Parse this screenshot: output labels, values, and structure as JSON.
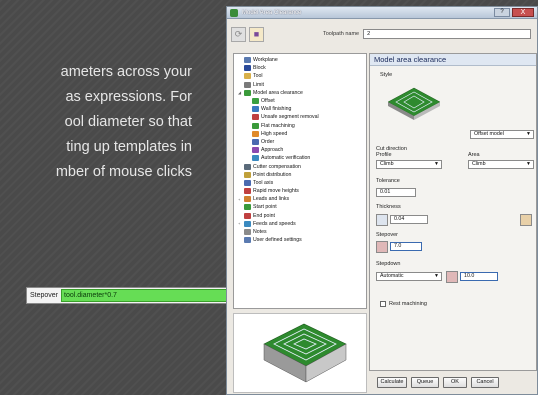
{
  "background_text": {
    "lines": [
      "ameters across your",
      "as expressions. For",
      "ool diameter so that",
      "ting up templates in",
      "mber of mouse clicks"
    ]
  },
  "expression_bar": {
    "label": "Stepover",
    "value": "tool.diameter*0.7",
    "accent_color": "#66dd55"
  },
  "dialog": {
    "title": "Model Area Clearance",
    "help_label": "?",
    "close_label": "X",
    "toolpath_name_label": "Toolpath name",
    "toolpath_name_value": "2",
    "tree": [
      {
        "label": "Workplane",
        "indent": 0,
        "color": "#5a7ab0"
      },
      {
        "label": "Block",
        "indent": 0,
        "color": "#2a4a9a"
      },
      {
        "label": "Tool",
        "indent": 0,
        "color": "#d8b04a"
      },
      {
        "label": "Limit",
        "indent": 0,
        "color": "#7a7a7a"
      },
      {
        "label": "Model area clearance",
        "indent": 0,
        "color": "#3a9a3a",
        "expanded": true
      },
      {
        "label": "Offset",
        "indent": 1,
        "color": "#3aa040"
      },
      {
        "label": "Wall finishing",
        "indent": 1,
        "color": "#3a7ac0"
      },
      {
        "label": "Unsafe segment removal",
        "indent": 1,
        "color": "#c04040"
      },
      {
        "label": "Flat machining",
        "indent": 1,
        "color": "#3a9a3a"
      },
      {
        "label": "High speed",
        "indent": 1,
        "color": "#e08a2a"
      },
      {
        "label": "Order",
        "indent": 1,
        "color": "#4a6ab0"
      },
      {
        "label": "Approach",
        "indent": 1,
        "color": "#8a4ab0"
      },
      {
        "label": "Automatic verification",
        "indent": 1,
        "color": "#3a8ac0"
      },
      {
        "label": "Cutter compensation",
        "indent": 0,
        "color": "#5a6a7a"
      },
      {
        "label": "Point distribution",
        "indent": 0,
        "color": "#c0a03a"
      },
      {
        "label": "Tool axis",
        "indent": 0,
        "color": "#4a6ab0"
      },
      {
        "label": "Rapid move heights",
        "indent": 0,
        "color": "#c04040"
      },
      {
        "label": "Leads and links",
        "indent": 0,
        "color": "#d08030",
        "expandable": true
      },
      {
        "label": "Start point",
        "indent": 0,
        "color": "#3a9a3a"
      },
      {
        "label": "End point",
        "indent": 0,
        "color": "#c04040"
      },
      {
        "label": "Feeds and speeds",
        "indent": 0,
        "color": "#3a8ac0",
        "expandable": true
      },
      {
        "label": "Notes",
        "indent": 0,
        "color": "#8a8a8a"
      },
      {
        "label": "User defined settings",
        "indent": 0,
        "color": "#5a7ab0"
      }
    ],
    "panel": {
      "title": "Model area clearance",
      "style_label": "Style",
      "style_value": "Offset model",
      "cut_direction_label": "Cut direction",
      "profile_label": "Profile",
      "profile_value": "Climb",
      "area_label": "Area",
      "area_value": "Climb",
      "tolerance_label": "Tolerance",
      "tolerance_value": "0.01",
      "thickness_label": "Thickness",
      "thickness_value": "0.04",
      "stepover_label": "Stepover",
      "stepover_value": "7.0",
      "stepdown_label": "Stepdown",
      "stepdown_mode": "Automatic",
      "stepdown_value": "10.0",
      "rest_machining_label": "Rest machining"
    },
    "buttons": {
      "calculate": "Calculate",
      "queue": "Queue",
      "ok": "OK",
      "cancel": "Cancel"
    }
  }
}
